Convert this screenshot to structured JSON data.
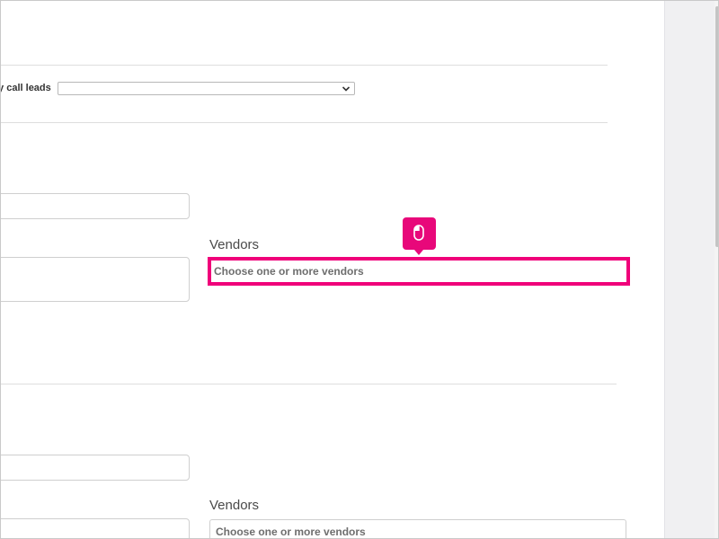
{
  "row": {
    "label": "ly call leads",
    "select_value": ""
  },
  "section1": {
    "vendors_label": "Vendors",
    "vendors_placeholder": "Choose one or more vendors",
    "field_top_value": "",
    "field_bottom_value": ""
  },
  "section2": {
    "vendors_label": "Vendors",
    "vendors_placeholder": "Choose one or more vendors",
    "field_top_value": "",
    "field_bottom_value": ""
  },
  "overlay": {
    "icon": "mouse-icon",
    "highlight_color": "#f0007a"
  },
  "colors": {
    "accent": "#e8087a",
    "border": "#cfcfcf",
    "label": "#4a4a4a",
    "placeholder": "#6e6e6e"
  }
}
